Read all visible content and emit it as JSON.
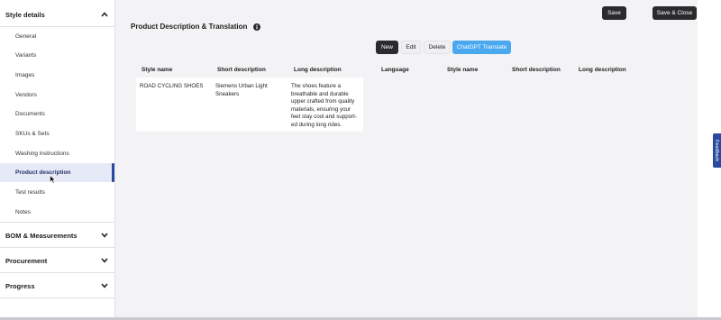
{
  "sidebar": {
    "sections": [
      {
        "label": "Style details",
        "chevron": "chevron-up-icon"
      },
      {
        "label": "BOM & Measurements",
        "chevron": "chevron-down-icon"
      },
      {
        "label": "Procurement",
        "chevron": "chevron-down-icon"
      },
      {
        "label": "Progress",
        "chevron": "chevron-down-icon"
      }
    ],
    "items": [
      {
        "label": "General"
      },
      {
        "label": "Variants"
      },
      {
        "label": "Images"
      },
      {
        "label": "Vendors"
      },
      {
        "label": "Documents"
      },
      {
        "label": "SKUs & Sets"
      },
      {
        "label": "Washing instructions"
      },
      {
        "label": "Product description",
        "active": true
      },
      {
        "label": "Test results"
      },
      {
        "label": "Notes"
      }
    ]
  },
  "header": {
    "save_label": "Save",
    "save_close_label": "Save & Close"
  },
  "main": {
    "title": "Product Description & Translation",
    "actions": {
      "new_label": "New",
      "edit_label": "Edit",
      "delete_label": "Delete",
      "translate_label": "ChatGPT Translate"
    },
    "columns": [
      "Style name",
      "Short description",
      "Long description",
      "Language",
      "Style name",
      "Short description",
      "Long description"
    ],
    "row": {
      "style_name": "ROAD CYCLING SHOES",
      "short_description": "Siemens Urban Light Sneakers",
      "long_description": "The shoes feature a breathable and durable upper crafted from quality materials, ensuring your feet stay cool and support-ed during long rides."
    }
  },
  "feedback_label": "Feedback",
  "colors": {
    "accent_blue": "#4aa8f0",
    "active_bar": "#2a4aa0",
    "dark_button": "#2b2b2e"
  }
}
